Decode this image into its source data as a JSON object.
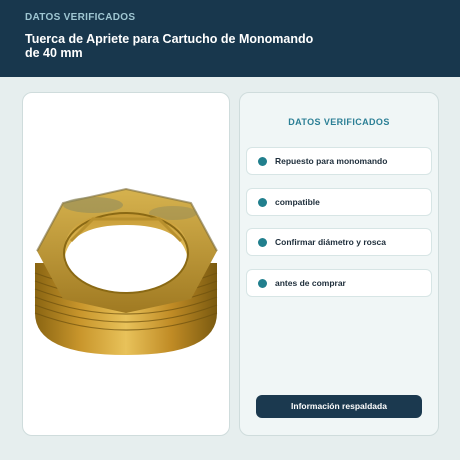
{
  "header": {
    "eyebrow": "DATOS VERIFICADOS",
    "title": "Tuerca de Apriete para Cartucho de Monomando de 40 mm"
  },
  "product_image": {
    "alt": "Tuerca hexagonal de latón con rosca exterior"
  },
  "info_card": {
    "title": "DATOS VERIFICADOS",
    "items": [
      {
        "label": "Repuesto para monomando"
      },
      {
        "label": "compatible"
      },
      {
        "label": "Confirmar diámetro y rosca"
      },
      {
        "label": "antes de comprar"
      }
    ],
    "button_label": "Información respaldada"
  },
  "colors": {
    "header_bg": "#18374d",
    "accent_teal": "#2b7f95",
    "bullet": "#217f8d",
    "button_bg": "#1b394f",
    "page_bg": "#e6eeee"
  }
}
